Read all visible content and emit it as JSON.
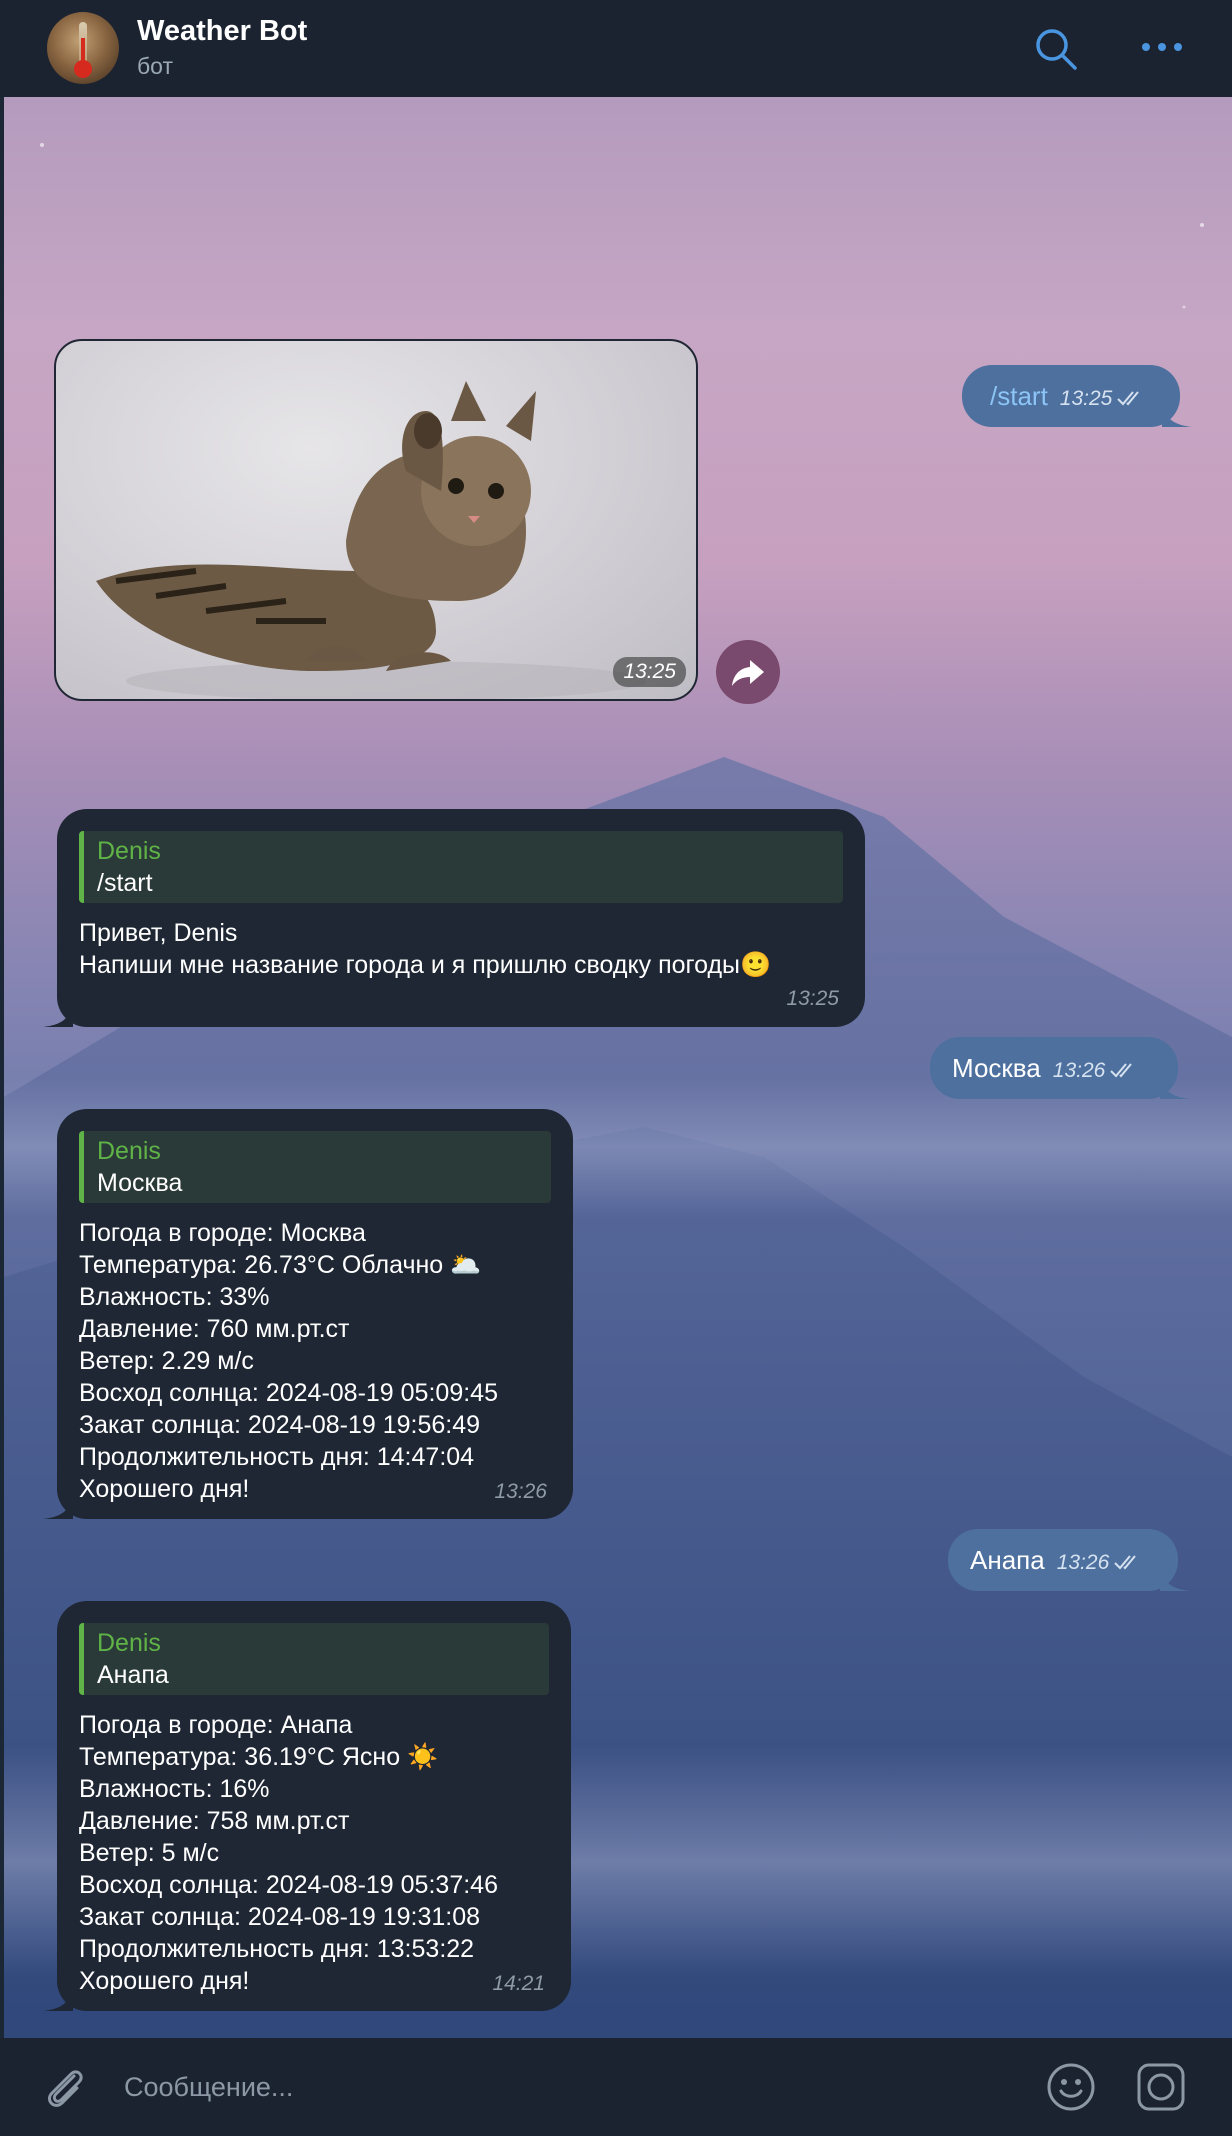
{
  "header": {
    "title": "Weather Bot",
    "subtitle": "бот"
  },
  "messages": {
    "start_out": {
      "text": "/start",
      "time": "13:25"
    },
    "photo": {
      "time": "13:25"
    },
    "greeting": {
      "reply_name": "Denis",
      "reply_text": "/start",
      "lines": [
        "Привет, Denis",
        "Напиши мне название города и я пришлю сводку погоды🙂"
      ],
      "time": "13:25"
    },
    "moscow_out": {
      "text": "Москва",
      "time": "13:26"
    },
    "moscow_in": {
      "reply_name": "Denis",
      "reply_text": "Москва",
      "lines": [
        "Погода в городе: Москва",
        "Температура: 26.73°C Облачно 🌥️",
        "Влажность: 33%",
        "Давление: 760 мм.рт.ст",
        "Ветер: 2.29 м/с",
        "Восход солнца: 2024-08-19 05:09:45",
        "Закат солнца: 2024-08-19 19:56:49",
        "Продолжительность дня: 14:47:04",
        "Хорошего дня!"
      ],
      "time": "13:26"
    },
    "anapa_out": {
      "text": "Анапа",
      "time": "13:26"
    },
    "anapa_in": {
      "reply_name": "Denis",
      "reply_text": "Анапа",
      "lines": [
        "Погода в городе: Анапа",
        "Температура: 36.19°C Ясно ☀️",
        "Влажность: 16%",
        "Давление: 758 мм.рт.ст",
        "Ветер: 5 м/с",
        "Восход солнца: 2024-08-19 05:37:46",
        "Закат солнца: 2024-08-19 19:31:08",
        "Продолжительность дня: 13:53:22",
        "Хорошего дня!"
      ],
      "time": "14:21"
    }
  },
  "composer": {
    "placeholder": "Сообщение..."
  },
  "colors": {
    "header_bg": "#1c2330",
    "outgoing_bubble": "#4d709e",
    "incoming_bubble": "#1f2734",
    "reply_accent": "#5fb347"
  }
}
